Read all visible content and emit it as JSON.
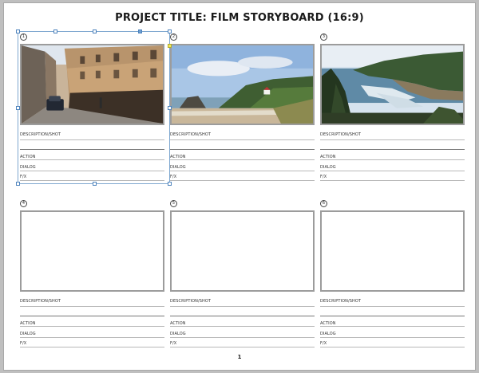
{
  "title": "PROJECT TITLE: FILM STORYBOARD (16:9)",
  "page_number": "1",
  "panels": [
    {
      "number": "1",
      "image": "street-photo",
      "description_label": "DESCRIPTION/SHOT",
      "action_label": "ACTION",
      "dialog_label": "DIALOG",
      "fx_label": "F/X"
    },
    {
      "number": "2",
      "image": "beach-lighthouse-photo",
      "description_label": "DESCRIPTION/SHOT",
      "action_label": "ACTION",
      "dialog_label": "DIALOG",
      "fx_label": "F/X"
    },
    {
      "number": "3",
      "image": "coastline-photo",
      "description_label": "DESCRIPTION/SHOT",
      "action_label": "ACTION",
      "dialog_label": "DIALOG",
      "fx_label": "F/X"
    },
    {
      "number": "4",
      "image": "",
      "description_label": "DESCRIPTION/SHOT",
      "action_label": "ACTION",
      "dialog_label": "DIALOG",
      "fx_label": "F/X"
    },
    {
      "number": "5",
      "image": "",
      "description_label": "DESCRIPTION/SHOT",
      "action_label": "ACTION",
      "dialog_label": "DIALOG",
      "fx_label": "F/X"
    },
    {
      "number": "6",
      "image": "",
      "description_label": "DESCRIPTION/SHOT",
      "action_label": "ACTION",
      "dialog_label": "DIALOG",
      "fx_label": "F/X"
    }
  ],
  "selection": {
    "selected_panel": "1",
    "handle_icon": "resize-handle-icon"
  }
}
